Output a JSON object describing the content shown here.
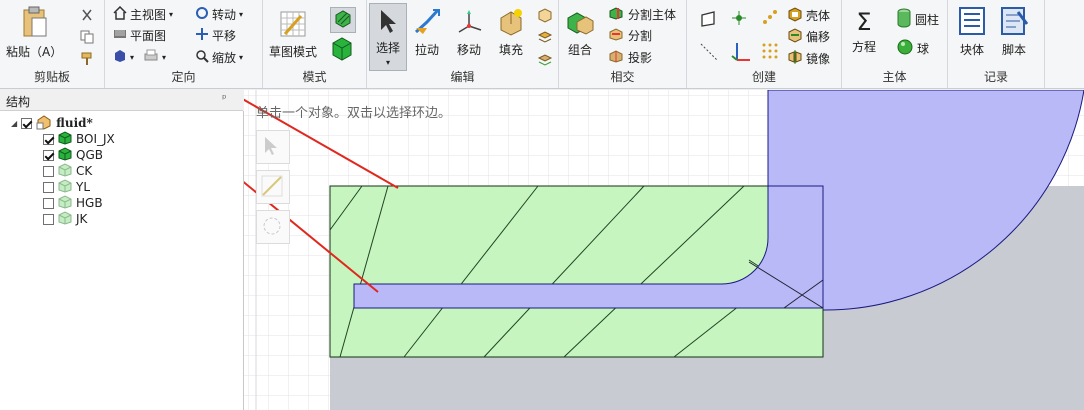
{
  "ribbon": {
    "clipboard": {
      "paste": "粘贴（A）",
      "group": "剪贴板"
    },
    "orient": {
      "main_view": "主视图",
      "plan_view": "平面图",
      "rotate": "转动",
      "pan": "平移",
      "zoom": "缩放",
      "group": "定向"
    },
    "mode": {
      "sketch_mode": "草图模式",
      "group": "模式"
    },
    "edit": {
      "select": "选择",
      "pull": "拉动",
      "move": "移动",
      "fill": "填充",
      "group": "编辑"
    },
    "intersect": {
      "combine": "组合",
      "split_body": "分割主体",
      "split": "分割",
      "project": "投影",
      "group": "相交"
    },
    "create": {
      "shell": "壳体",
      "offset": "偏移",
      "mirror": "镜像",
      "group": "创建"
    },
    "body": {
      "equation": "方程",
      "cylinder": "圆柱",
      "sphere": "球",
      "group": "主体"
    },
    "record": {
      "block": "块体",
      "script": "脚本",
      "group": "记录"
    }
  },
  "structure": {
    "title": "结构",
    "pin": "ᵖ",
    "root": {
      "label": "fluid*",
      "expander": "◢"
    },
    "items": [
      {
        "label": "BOI_JX",
        "checked": true,
        "visible": true
      },
      {
        "label": "QGB",
        "checked": true,
        "visible": true
      },
      {
        "label": "CK",
        "checked": false,
        "visible": false
      },
      {
        "label": "YL",
        "checked": false,
        "visible": false
      },
      {
        "label": "HGB",
        "checked": false,
        "visible": false
      },
      {
        "label": "JK",
        "checked": false,
        "visible": false
      }
    ]
  },
  "viewport": {
    "hint": "单击一个对象。双击以选择环边。"
  },
  "colors": {
    "green_fill": "#c6f5c0",
    "blue_fill": "#b9b9f7",
    "gray_fill": "#c9cbd3",
    "arrow_red": "#e0281e"
  }
}
